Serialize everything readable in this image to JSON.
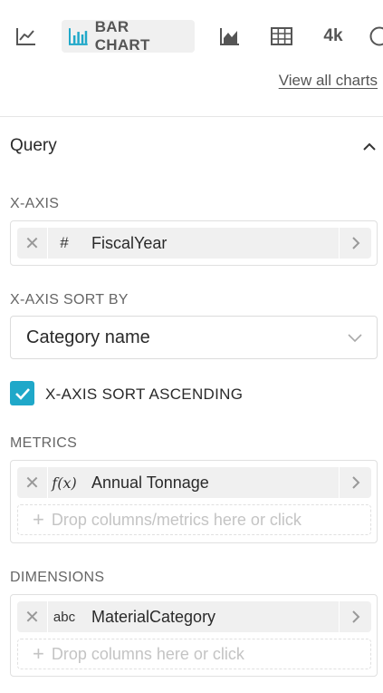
{
  "chart_types": {
    "line": {
      "icon": "line-chart-icon"
    },
    "bar": {
      "icon": "bar-chart-icon",
      "label": "BAR CHART"
    },
    "area": {
      "icon": "area-chart-icon"
    },
    "table": {
      "icon": "table-icon"
    },
    "big_number": {
      "label": "4k"
    },
    "more": {
      "icon": "more-icon"
    }
  },
  "view_all_label": "View all charts",
  "query": {
    "title": "Query",
    "collapse_icon": "chevron-up-icon",
    "x_axis": {
      "label": "X-AXIS",
      "item": {
        "type_glyph": "#",
        "name": "FiscalYear"
      }
    },
    "x_axis_sort_by": {
      "label": "X-AXIS SORT BY",
      "value": "Category name",
      "icon": "chevron-down-icon"
    },
    "x_axis_sort_ascending": {
      "label": "X-AXIS SORT ASCENDING",
      "checked": true
    },
    "metrics": {
      "label": "METRICS",
      "item": {
        "type_glyph": "f(x)",
        "name": "Annual Tonnage"
      },
      "drop_placeholder": "Drop columns/metrics here or click"
    },
    "dimensions": {
      "label": "DIMENSIONS",
      "item": {
        "type_glyph": "abc",
        "name": "MaterialCategory"
      },
      "drop_placeholder": "Drop columns here or click"
    }
  },
  "colors": {
    "accent": "#1fa8c9",
    "pill_bg": "#f0f0f0",
    "muted_text": "#666666"
  }
}
